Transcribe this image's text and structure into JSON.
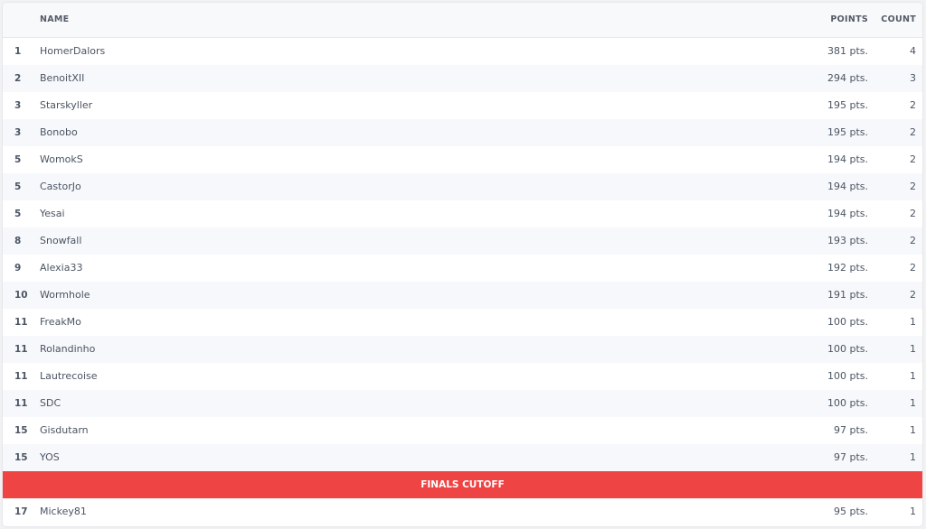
{
  "header": {
    "rank": "",
    "name": "NAME",
    "points": "POINTS",
    "count": "COUNT"
  },
  "rows_before": [
    {
      "rank": "1",
      "name": "HomerDalors",
      "points": "381 pts.",
      "count": "4"
    },
    {
      "rank": "2",
      "name": "BenoitXII",
      "points": "294 pts.",
      "count": "3"
    },
    {
      "rank": "3",
      "name": "Starskyller",
      "points": "195 pts.",
      "count": "2"
    },
    {
      "rank": "3",
      "name": "Bonobo",
      "points": "195 pts.",
      "count": "2"
    },
    {
      "rank": "5",
      "name": "WomokS",
      "points": "194 pts.",
      "count": "2"
    },
    {
      "rank": "5",
      "name": "CastorJo",
      "points": "194 pts.",
      "count": "2"
    },
    {
      "rank": "5",
      "name": "Yesai",
      "points": "194 pts.",
      "count": "2"
    },
    {
      "rank": "8",
      "name": "Snowfall",
      "points": "193 pts.",
      "count": "2"
    },
    {
      "rank": "9",
      "name": "Alexia33",
      "points": "192 pts.",
      "count": "2"
    },
    {
      "rank": "10",
      "name": "Wormhole",
      "points": "191 pts.",
      "count": "2"
    },
    {
      "rank": "11",
      "name": "FreakMo",
      "points": "100 pts.",
      "count": "1"
    },
    {
      "rank": "11",
      "name": "Rolandinho",
      "points": "100 pts.",
      "count": "1"
    },
    {
      "rank": "11",
      "name": "Lautrecoise",
      "points": "100 pts.",
      "count": "1"
    },
    {
      "rank": "11",
      "name": "SDC",
      "points": "100 pts.",
      "count": "1"
    },
    {
      "rank": "15",
      "name": "Gisdutarn",
      "points": "97 pts.",
      "count": "1"
    },
    {
      "rank": "15",
      "name": "YOS",
      "points": "97 pts.",
      "count": "1"
    }
  ],
  "cutoff": {
    "label": "FINALS CUTOFF",
    "color": "#ef4444"
  },
  "rows_after": [
    {
      "rank": "17",
      "name": "Mickey81",
      "points": "95 pts.",
      "count": "1"
    }
  ]
}
